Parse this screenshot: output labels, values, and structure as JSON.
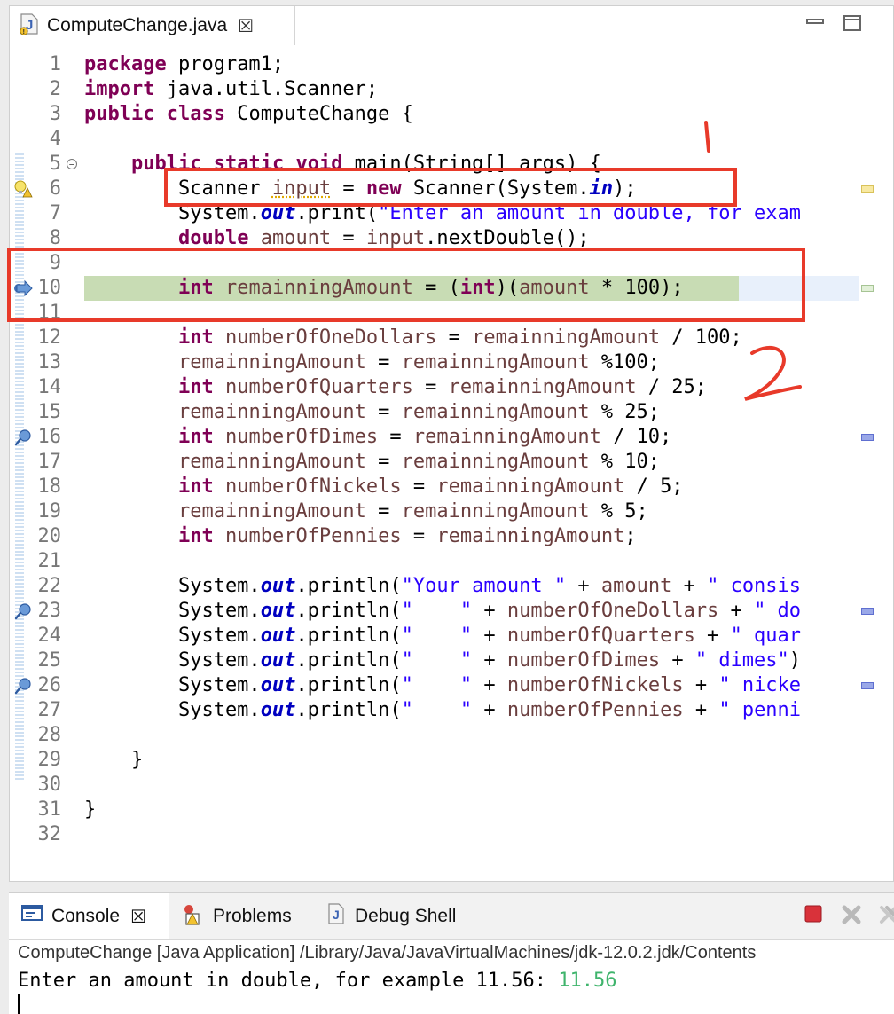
{
  "editor": {
    "tab_title": "ComputeChange.java",
    "tab_close": "☒"
  },
  "code_lines": [
    {
      "n": "1",
      "tokens": [
        {
          "t": "package",
          "c": "kw"
        },
        {
          "t": " program1;",
          "c": ""
        }
      ]
    },
    {
      "n": "2",
      "tokens": [
        {
          "t": "import",
          "c": "kw"
        },
        {
          "t": " java.util.Scanner;",
          "c": ""
        }
      ]
    },
    {
      "n": "3",
      "tokens": [
        {
          "t": "public",
          "c": "kw"
        },
        {
          "t": " ",
          "c": ""
        },
        {
          "t": "class",
          "c": "kw"
        },
        {
          "t": " ComputeChange {",
          "c": ""
        }
      ]
    },
    {
      "n": "4",
      "tokens": []
    },
    {
      "n": "5",
      "tokens": [
        {
          "t": "    ",
          "c": ""
        },
        {
          "t": "public",
          "c": "kw"
        },
        {
          "t": " ",
          "c": ""
        },
        {
          "t": "static",
          "c": "kw"
        },
        {
          "t": " ",
          "c": ""
        },
        {
          "t": "void",
          "c": "kw"
        },
        {
          "t": " main(String[] args) {",
          "c": ""
        }
      ]
    },
    {
      "n": "6",
      "tokens": [
        {
          "t": "        Scanner ",
          "c": ""
        },
        {
          "t": "input",
          "c": "var"
        },
        {
          "t": " = ",
          "c": ""
        },
        {
          "t": "new",
          "c": "kw"
        },
        {
          "t": " Scanner(System.",
          "c": ""
        },
        {
          "t": "in",
          "c": "fld"
        },
        {
          "t": ");",
          "c": ""
        }
      ]
    },
    {
      "n": "7",
      "tokens": [
        {
          "t": "        System.",
          "c": ""
        },
        {
          "t": "out",
          "c": "fld"
        },
        {
          "t": ".print(",
          "c": ""
        },
        {
          "t": "\"Enter an amount in double, for exam",
          "c": "str"
        }
      ]
    },
    {
      "n": "8",
      "tokens": [
        {
          "t": "        ",
          "c": ""
        },
        {
          "t": "double",
          "c": "kw"
        },
        {
          "t": " ",
          "c": ""
        },
        {
          "t": "amount",
          "c": "var"
        },
        {
          "t": " = ",
          "c": ""
        },
        {
          "t": "input",
          "c": "var"
        },
        {
          "t": ".nextDouble();",
          "c": ""
        }
      ]
    },
    {
      "n": "9",
      "tokens": []
    },
    {
      "n": "10",
      "tokens": [
        {
          "t": "        ",
          "c": ""
        },
        {
          "t": "int",
          "c": "kw"
        },
        {
          "t": " ",
          "c": ""
        },
        {
          "t": "remainningAmount",
          "c": "var"
        },
        {
          "t": " = (",
          "c": ""
        },
        {
          "t": "int",
          "c": "kw"
        },
        {
          "t": ")(",
          "c": ""
        },
        {
          "t": "amount",
          "c": "var"
        },
        {
          "t": " * 100);",
          "c": ""
        }
      ]
    },
    {
      "n": "11",
      "tokens": []
    },
    {
      "n": "12",
      "tokens": [
        {
          "t": "        ",
          "c": ""
        },
        {
          "t": "int",
          "c": "kw"
        },
        {
          "t": " ",
          "c": ""
        },
        {
          "t": "numberOfOneDollars",
          "c": "var"
        },
        {
          "t": " = ",
          "c": ""
        },
        {
          "t": "remainningAmount",
          "c": "var"
        },
        {
          "t": " / 100;",
          "c": ""
        }
      ]
    },
    {
      "n": "13",
      "tokens": [
        {
          "t": "        ",
          "c": ""
        },
        {
          "t": "remainningAmount",
          "c": "var"
        },
        {
          "t": " = ",
          "c": ""
        },
        {
          "t": "remainningAmount",
          "c": "var"
        },
        {
          "t": " %100;",
          "c": ""
        }
      ]
    },
    {
      "n": "14",
      "tokens": [
        {
          "t": "        ",
          "c": ""
        },
        {
          "t": "int",
          "c": "kw"
        },
        {
          "t": " ",
          "c": ""
        },
        {
          "t": "numberOfQuarters",
          "c": "var"
        },
        {
          "t": " = ",
          "c": ""
        },
        {
          "t": "remainningAmount",
          "c": "var"
        },
        {
          "t": " / 25;",
          "c": ""
        }
      ]
    },
    {
      "n": "15",
      "tokens": [
        {
          "t": "        ",
          "c": ""
        },
        {
          "t": "remainningAmount",
          "c": "var"
        },
        {
          "t": " = ",
          "c": ""
        },
        {
          "t": "remainningAmount",
          "c": "var"
        },
        {
          "t": " % 25;",
          "c": ""
        }
      ]
    },
    {
      "n": "16",
      "tokens": [
        {
          "t": "        ",
          "c": ""
        },
        {
          "t": "int",
          "c": "kw"
        },
        {
          "t": " ",
          "c": ""
        },
        {
          "t": "numberOfDimes",
          "c": "var"
        },
        {
          "t": " = ",
          "c": ""
        },
        {
          "t": "remainningAmount",
          "c": "var"
        },
        {
          "t": " / 10;",
          "c": ""
        }
      ]
    },
    {
      "n": "17",
      "tokens": [
        {
          "t": "        ",
          "c": ""
        },
        {
          "t": "remainningAmount",
          "c": "var"
        },
        {
          "t": " = ",
          "c": ""
        },
        {
          "t": "remainningAmount",
          "c": "var"
        },
        {
          "t": " % 10;",
          "c": ""
        }
      ]
    },
    {
      "n": "18",
      "tokens": [
        {
          "t": "        ",
          "c": ""
        },
        {
          "t": "int",
          "c": "kw"
        },
        {
          "t": " ",
          "c": ""
        },
        {
          "t": "numberOfNickels",
          "c": "var"
        },
        {
          "t": " = ",
          "c": ""
        },
        {
          "t": "remainningAmount",
          "c": "var"
        },
        {
          "t": " / 5;",
          "c": ""
        }
      ]
    },
    {
      "n": "19",
      "tokens": [
        {
          "t": "        ",
          "c": ""
        },
        {
          "t": "remainningAmount",
          "c": "var"
        },
        {
          "t": " = ",
          "c": ""
        },
        {
          "t": "remainningAmount",
          "c": "var"
        },
        {
          "t": " % 5;",
          "c": ""
        }
      ]
    },
    {
      "n": "20",
      "tokens": [
        {
          "t": "        ",
          "c": ""
        },
        {
          "t": "int",
          "c": "kw"
        },
        {
          "t": " ",
          "c": ""
        },
        {
          "t": "numberOfPennies",
          "c": "var"
        },
        {
          "t": " = ",
          "c": ""
        },
        {
          "t": "remainningAmount",
          "c": "var"
        },
        {
          "t": ";",
          "c": ""
        }
      ]
    },
    {
      "n": "21",
      "tokens": []
    },
    {
      "n": "22",
      "tokens": [
        {
          "t": "        System.",
          "c": ""
        },
        {
          "t": "out",
          "c": "fld"
        },
        {
          "t": ".println(",
          "c": ""
        },
        {
          "t": "\"Your amount \"",
          "c": "str"
        },
        {
          "t": " + ",
          "c": ""
        },
        {
          "t": "amount",
          "c": "var"
        },
        {
          "t": " + ",
          "c": ""
        },
        {
          "t": "\" consis",
          "c": "str"
        }
      ]
    },
    {
      "n": "23",
      "tokens": [
        {
          "t": "        System.",
          "c": ""
        },
        {
          "t": "out",
          "c": "fld"
        },
        {
          "t": ".println(",
          "c": ""
        },
        {
          "t": "\"    \"",
          "c": "str"
        },
        {
          "t": " + ",
          "c": ""
        },
        {
          "t": "numberOfOneDollars",
          "c": "var"
        },
        {
          "t": " + ",
          "c": ""
        },
        {
          "t": "\" do",
          "c": "str"
        }
      ]
    },
    {
      "n": "24",
      "tokens": [
        {
          "t": "        System.",
          "c": ""
        },
        {
          "t": "out",
          "c": "fld"
        },
        {
          "t": ".println(",
          "c": ""
        },
        {
          "t": "\"    \"",
          "c": "str"
        },
        {
          "t": " + ",
          "c": ""
        },
        {
          "t": "numberOfQuarters",
          "c": "var"
        },
        {
          "t": " + ",
          "c": ""
        },
        {
          "t": "\" quar",
          "c": "str"
        }
      ]
    },
    {
      "n": "25",
      "tokens": [
        {
          "t": "        System.",
          "c": ""
        },
        {
          "t": "out",
          "c": "fld"
        },
        {
          "t": ".println(",
          "c": ""
        },
        {
          "t": "\"    \"",
          "c": "str"
        },
        {
          "t": " + ",
          "c": ""
        },
        {
          "t": "numberOfDimes",
          "c": "var"
        },
        {
          "t": " + ",
          "c": ""
        },
        {
          "t": "\" dimes\"",
          "c": "str"
        },
        {
          "t": ")",
          "c": ""
        }
      ]
    },
    {
      "n": "26",
      "tokens": [
        {
          "t": "        System.",
          "c": ""
        },
        {
          "t": "out",
          "c": "fld"
        },
        {
          "t": ".println(",
          "c": ""
        },
        {
          "t": "\"    \"",
          "c": "str"
        },
        {
          "t": " + ",
          "c": ""
        },
        {
          "t": "numberOfNickels",
          "c": "var"
        },
        {
          "t": " + ",
          "c": ""
        },
        {
          "t": "\" nicke",
          "c": "str"
        }
      ]
    },
    {
      "n": "27",
      "tokens": [
        {
          "t": "        System.",
          "c": ""
        },
        {
          "t": "out",
          "c": "fld"
        },
        {
          "t": ".println(",
          "c": ""
        },
        {
          "t": "\"    \"",
          "c": "str"
        },
        {
          "t": " + ",
          "c": ""
        },
        {
          "t": "numberOfPennies",
          "c": "var"
        },
        {
          "t": " + ",
          "c": ""
        },
        {
          "t": "\" penni",
          "c": "str"
        }
      ]
    },
    {
      "n": "28",
      "tokens": []
    },
    {
      "n": "29",
      "tokens": [
        {
          "t": "    }",
          "c": ""
        }
      ]
    },
    {
      "n": "30",
      "tokens": []
    },
    {
      "n": "31",
      "tokens": [
        {
          "t": "}",
          "c": ""
        }
      ]
    },
    {
      "n": "32",
      "tokens": []
    }
  ],
  "annotations": {
    "mark1": "1",
    "mark2": "2"
  },
  "console": {
    "tab_console": "Console",
    "tab_console_close": "☒",
    "tab_problems": "Problems",
    "tab_debug_shell": "Debug Shell",
    "launch_info": "ComputeChange [Java Application] /Library/Java/JavaVirtualMachines/jdk-12.0.2.jdk/Contents",
    "prompt": "Enter an amount in double, for example 11.56: ",
    "user_input": "11.56"
  },
  "colors": {
    "keyword": "#7f0055",
    "string": "#2a00ff",
    "field": "#0000c0",
    "variable": "#6a3e3e",
    "current_line": "#c8dcb4",
    "annotation": "#e83a2a"
  }
}
